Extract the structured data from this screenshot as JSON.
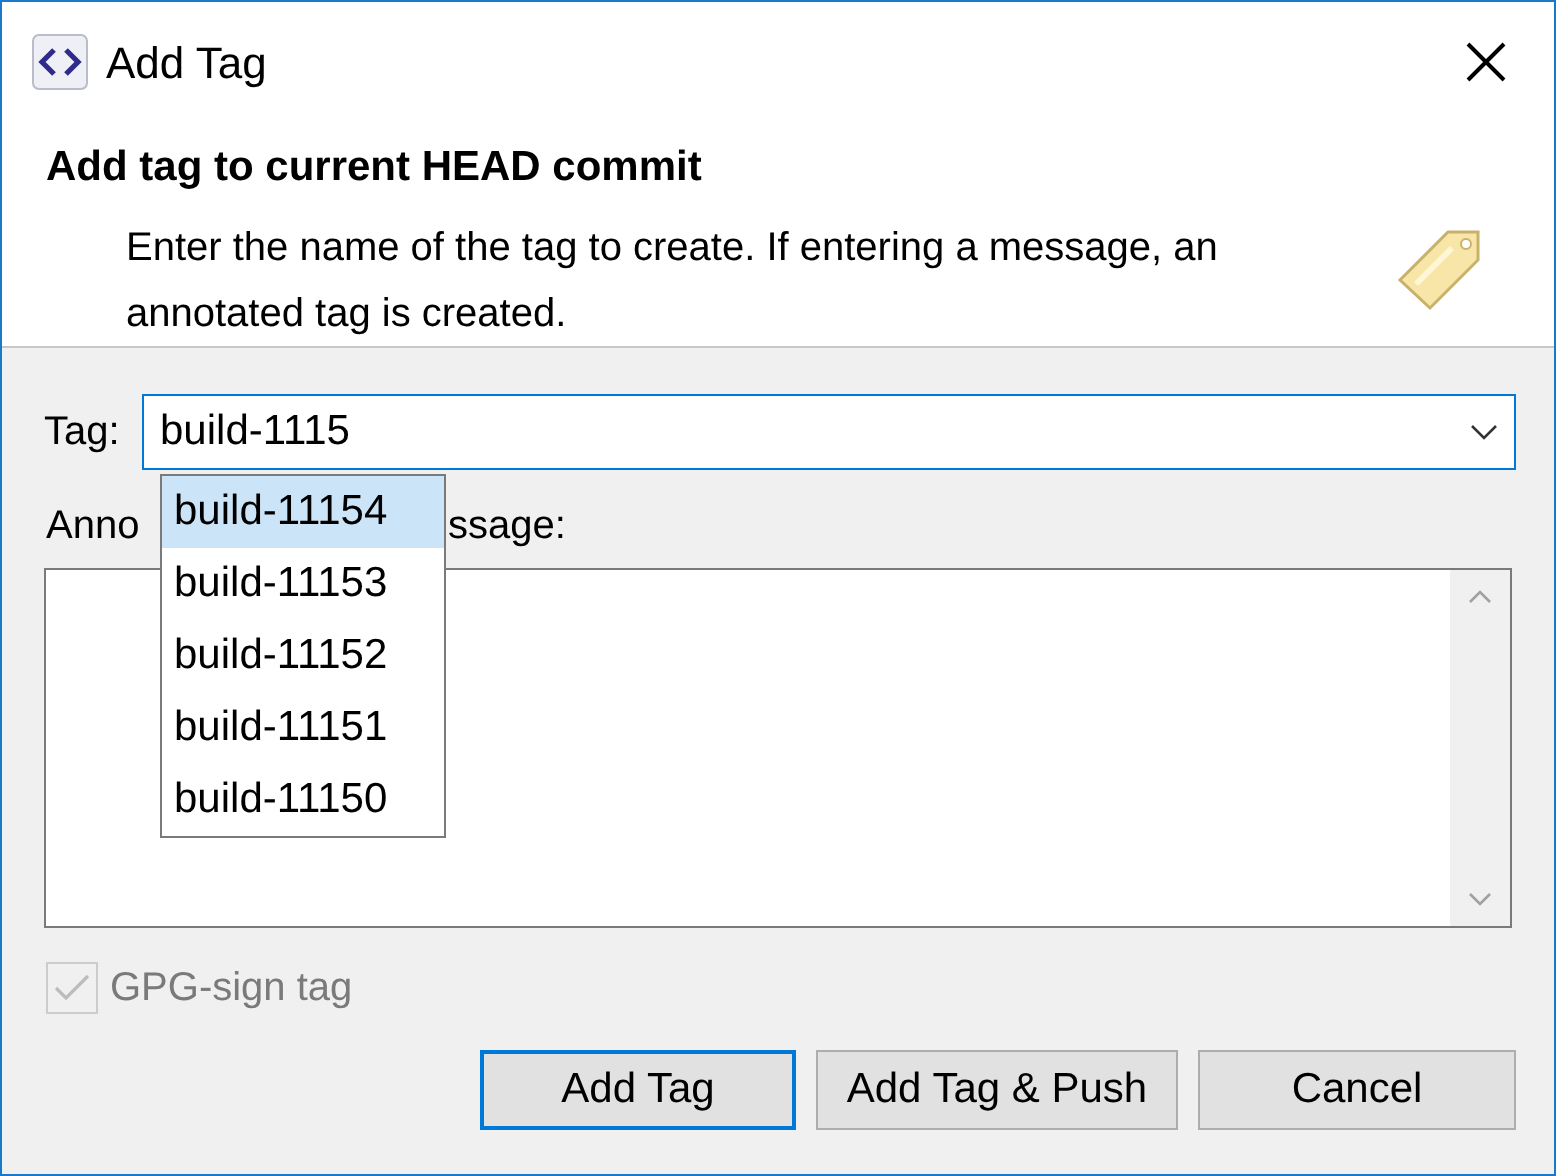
{
  "window": {
    "title": "Add Tag"
  },
  "header": {
    "title": "Add tag to current HEAD commit",
    "description": "Enter the name of the tag to create. If entering a message, an annotated tag is created."
  },
  "tag_field": {
    "label": "Tag:",
    "value": "build-1115"
  },
  "suggestions": [
    {
      "label": "build-11154",
      "selected": true
    },
    {
      "label": "build-11153",
      "selected": false
    },
    {
      "label": "build-11152",
      "selected": false
    },
    {
      "label": "build-11151",
      "selected": false
    },
    {
      "label": "build-11150",
      "selected": false
    }
  ],
  "message_label_parts": [
    "Anno",
    "ssage:"
  ],
  "gpg_sign": {
    "label": "GPG-sign tag",
    "checked": true,
    "disabled": true
  },
  "buttons": [
    {
      "label": "Add Tag",
      "default": true
    },
    {
      "label": "Add Tag & Push",
      "default": false
    },
    {
      "label": "Cancel",
      "default": false
    }
  ]
}
